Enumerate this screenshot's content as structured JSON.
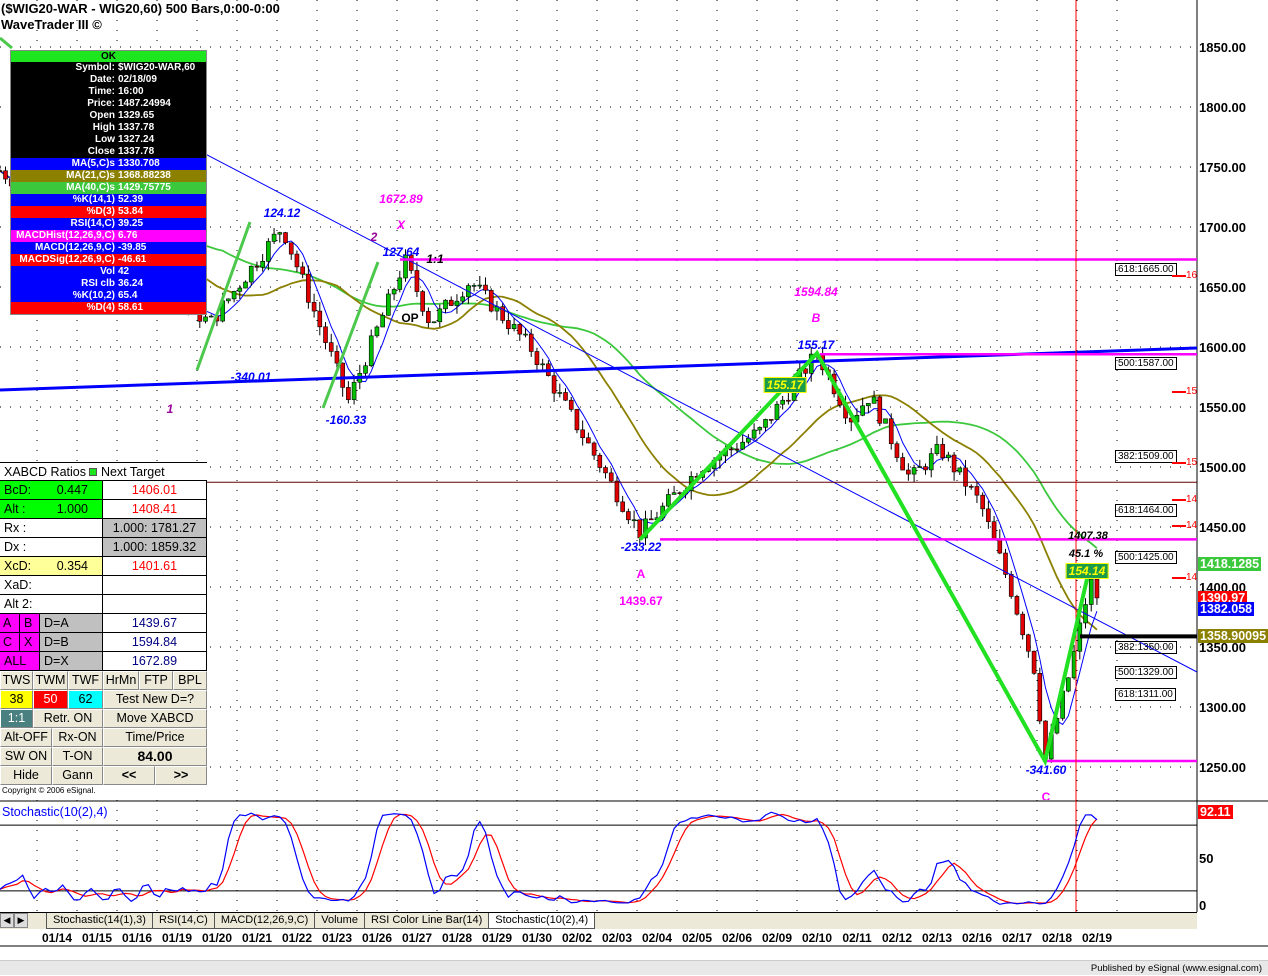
{
  "header": {
    "title": "($WIG20-WAR - WIG20,60) 500 Bars,0:00-0:00",
    "subtitle": "WaveTrader III ©"
  },
  "data_window": {
    "ok": "OK",
    "rows": [
      {
        "k": "Symbol:",
        "v": "$WIG20-WAR,60",
        "bg": "#000000"
      },
      {
        "k": "Date:",
        "v": "02/18/09",
        "bg": "#000000"
      },
      {
        "k": "Time:",
        "v": "16:00",
        "bg": "#000000"
      },
      {
        "k": "Price:",
        "v": "1487.24994",
        "bg": "#000000"
      },
      {
        "k": "Open",
        "v": "1329.65",
        "bg": "#000000"
      },
      {
        "k": "High",
        "v": "1337.78",
        "bg": "#000000"
      },
      {
        "k": "Low",
        "v": "1327.24",
        "bg": "#000000"
      },
      {
        "k": "Close",
        "v": "1337.78",
        "bg": "#000000"
      },
      {
        "k": "MA(5,C)s",
        "v": "1330.708",
        "bg": "#0000ff"
      },
      {
        "k": "MA(21,C)s",
        "v": "1368.88238",
        "bg": "#8b8000"
      },
      {
        "k": "MA(40,C)s",
        "v": "1429.75775",
        "bg": "#3cc83c"
      },
      {
        "k": "%K(14,1)",
        "v": "52.39",
        "bg": "#0000ff"
      },
      {
        "k": "%D(3)",
        "v": "53.84",
        "bg": "#ff0000"
      },
      {
        "k": "RSI(14,C)",
        "v": "39.25",
        "bg": "#0000ff"
      },
      {
        "k": "MACDHist(12,26,9,C)",
        "v": "6.76",
        "bg": "#ff00ff"
      },
      {
        "k": "MACD(12,26,9,C)",
        "v": "-39.85",
        "bg": "#0000ff"
      },
      {
        "k": "MACDSig(12,26,9,C)",
        "v": "-46.61",
        "bg": "#ff0000"
      },
      {
        "k": "Vol",
        "v": "42",
        "bg": "#0000ff"
      },
      {
        "k": "RSI clb",
        "v": "36.24",
        "bg": "#0000ff"
      },
      {
        "k": "%K(10,2)",
        "v": "65.4",
        "bg": "#0000ff"
      },
      {
        "k": "%D(4)",
        "v": "58.61",
        "bg": "#ff0000"
      }
    ]
  },
  "xabcd": {
    "header_left": "XABCD Ratios",
    "header_right": "Next Target",
    "rows": [
      {
        "label": "BcD:",
        "val": "0.447",
        "target": "1406.01",
        "lbg": "#00ff00",
        "tbg": "#ffffff",
        "tcolor": "#ff0000"
      },
      {
        "label": "Alt  :",
        "val": "1.000",
        "target": "1408.41",
        "lbg": "#00ff00",
        "tbg": "#ffffff",
        "tcolor": "#ff0000"
      },
      {
        "label": "Rx  :",
        "val": "",
        "target": "1.000: 1781.27",
        "lbg": "#ffffff",
        "tbg": "#c0c0c0",
        "tcolor": "#000000"
      },
      {
        "label": "Dx  :",
        "val": "",
        "target": "1.000: 1859.32",
        "lbg": "#ffffff",
        "tbg": "#c0c0c0",
        "tcolor": "#000000"
      },
      {
        "label": "XcD:",
        "val": "0.354",
        "target": "1401.61",
        "lbg": "#ffff99",
        "tbg": "#ffffff",
        "tcolor": "#ff0000"
      },
      {
        "label": "XaD:",
        "val": "",
        "target": "",
        "lbg": "#ffffff",
        "tbg": "#ffffff",
        "tcolor": "#000000"
      },
      {
        "label": "Alt 2:",
        "val": "",
        "target": "",
        "lbg": "#ffffff",
        "tbg": "#ffffff",
        "tcolor": "#000000"
      }
    ],
    "d_rows": [
      {
        "b1": "A",
        "b2": "B",
        "label": "D=A",
        "target": "1439.67"
      },
      {
        "b1": "C",
        "b2": "X",
        "label": "D=B",
        "target": "1594.84"
      },
      {
        "b1": "ALL",
        "b2": "",
        "label": "D=X",
        "target": "1672.89"
      }
    ],
    "buttons": {
      "tws": "TWS",
      "twm": "TWM",
      "twf": "TWF",
      "hrmn": "HrMn",
      "ftp": "FTP",
      "bpl": "BPL",
      "r38": "38",
      "r50": "50",
      "r62": "62",
      "test_new_d": "Test New D=?",
      "one_one": "1:1",
      "retr_on": "Retr. ON",
      "move_xabcd": "Move XABCD",
      "alt_off": "Alt-OFF",
      "rx_on": "Rx-ON",
      "time_price": "Time/Price",
      "sw_on": "SW ON",
      "t_on": "T-ON",
      "value": "84.00",
      "hide": "Hide",
      "gann": "Gann",
      "prev": "<<",
      "next": ">>"
    },
    "copyright": "Copyright © 2006 eSignal."
  },
  "price_axis": {
    "labels": [
      "1850.00",
      "1800.00",
      "1750.00",
      "1700.00",
      "1650.00",
      "1600.00",
      "1550.00",
      "1500.00",
      "1450.00",
      "1400.00",
      "1350.00",
      "1300.00",
      "1250.00"
    ],
    "boxes": [
      {
        "text": "1418.1285",
        "color": "#3cc83c"
      },
      {
        "text": "1390.97",
        "color": "#ff0000"
      },
      {
        "text": "1382.058",
        "color": "#0000ff"
      },
      {
        "text": "1358.90095",
        "color": "#8b8000"
      }
    ]
  },
  "fib_boxes": [
    {
      "text": "618:1665.00",
      "color": "#00ffff"
    },
    {
      "text": "500:1587.00",
      "color": "#ff0000"
    },
    {
      "text": "382:1509.00",
      "color": "#ffff00"
    },
    {
      "text": "618:1464.00",
      "color": "#00ffff"
    },
    {
      "text": "500:1425.00",
      "color": "#ff0000"
    },
    {
      "text": "382:1350.00",
      "color": "#ffff00"
    },
    {
      "text": "500:1329.00",
      "color": "#ff0000"
    },
    {
      "text": "618:1311.00",
      "color": "#00ffff"
    }
  ],
  "red_ticks": [
    "16",
    "15",
    "15",
    "14",
    "14",
    "14",
    "14"
  ],
  "annotations": {
    "a124": "124.12",
    "x_price": "1672.89",
    "x_label": "X",
    "two": "2",
    "a127": "127.64",
    "one_one": "1:1",
    "op": "OP",
    "a340": "-340.01",
    "one": "1",
    "a160": "-160.33",
    "b_price": "1594.84",
    "b_label": "B",
    "a155": "155.17",
    "a155box": "155.17",
    "a233": "-233.22",
    "a_label": "A",
    "a_price": "1439.67",
    "c1407": "1407.38",
    "pct": "45.1 %",
    "d154": "154.14",
    "a341": "-341.60",
    "c_label": "C"
  },
  "stochastic": {
    "title": "Stochastic(10(2),4)",
    "value_box": "92.11",
    "axis": [
      "50",
      "0"
    ]
  },
  "tabs": [
    "Stochastic(14(1),3)",
    "RSI(14,C)",
    "MACD(12,26,9,C)",
    "Volume",
    "RSI Color Line Bar(14)",
    "Stochastic(10(2),4)"
  ],
  "active_tab": 5,
  "status": "Published by eSignal (www.esignal.com)",
  "chart_data": {
    "type": "candlestick",
    "symbol": "$WIG20-WAR,60",
    "dates": [
      "01/14",
      "01/15",
      "01/16",
      "01/19",
      "01/20",
      "01/21",
      "01/22",
      "01/23",
      "01/26",
      "01/27",
      "01/28",
      "01/29",
      "01/30",
      "02/02",
      "02/03",
      "02/04",
      "02/05",
      "02/06",
      "02/09",
      "02/10",
      "02/11",
      "02/12",
      "02/13",
      "02/16",
      "02/17",
      "02/18",
      "02/19"
    ],
    "ylim": [
      1230,
      1885
    ],
    "swing_path": [
      [
        -0.93,
        1747
      ],
      [
        4.33,
        1620
      ],
      [
        6.13,
        1700
      ],
      [
        7.78,
        1555
      ],
      [
        9.2,
        1672
      ],
      [
        9.83,
        1620
      ],
      [
        10.83,
        1655
      ],
      [
        12.33,
        1600
      ],
      [
        13.58,
        1530
      ],
      [
        15.08,
        1445
      ],
      [
        16.58,
        1500
      ],
      [
        18.08,
        1530
      ],
      [
        19.5,
        1595
      ],
      [
        20.33,
        1540
      ],
      [
        20.83,
        1560
      ],
      [
        21.83,
        1490
      ],
      [
        22.58,
        1515
      ],
      [
        23.58,
        1470
      ],
      [
        24.33,
        1400
      ],
      [
        24.95,
        1330
      ],
      [
        25.2,
        1255
      ],
      [
        25.83,
        1330
      ],
      [
        26.33,
        1405
      ],
      [
        26.53,
        1390
      ]
    ],
    "moving_averages": [
      {
        "name": "MA(5,C)",
        "color": "#0000ff"
      },
      {
        "name": "MA(21,C)",
        "color": "#8b8000"
      },
      {
        "name": "MA(40,C)",
        "color": "#3cc83c"
      }
    ],
    "xabcd_pattern": {
      "A": 1439.67,
      "B": 1594.84,
      "C": 1255,
      "D": 1418.13
    },
    "horizontal_levels": [
      1672.89,
      1594.84,
      1439.67,
      1255,
      1358.9,
      1487.25
    ],
    "stochastic_levels": [
      80,
      20
    ]
  }
}
